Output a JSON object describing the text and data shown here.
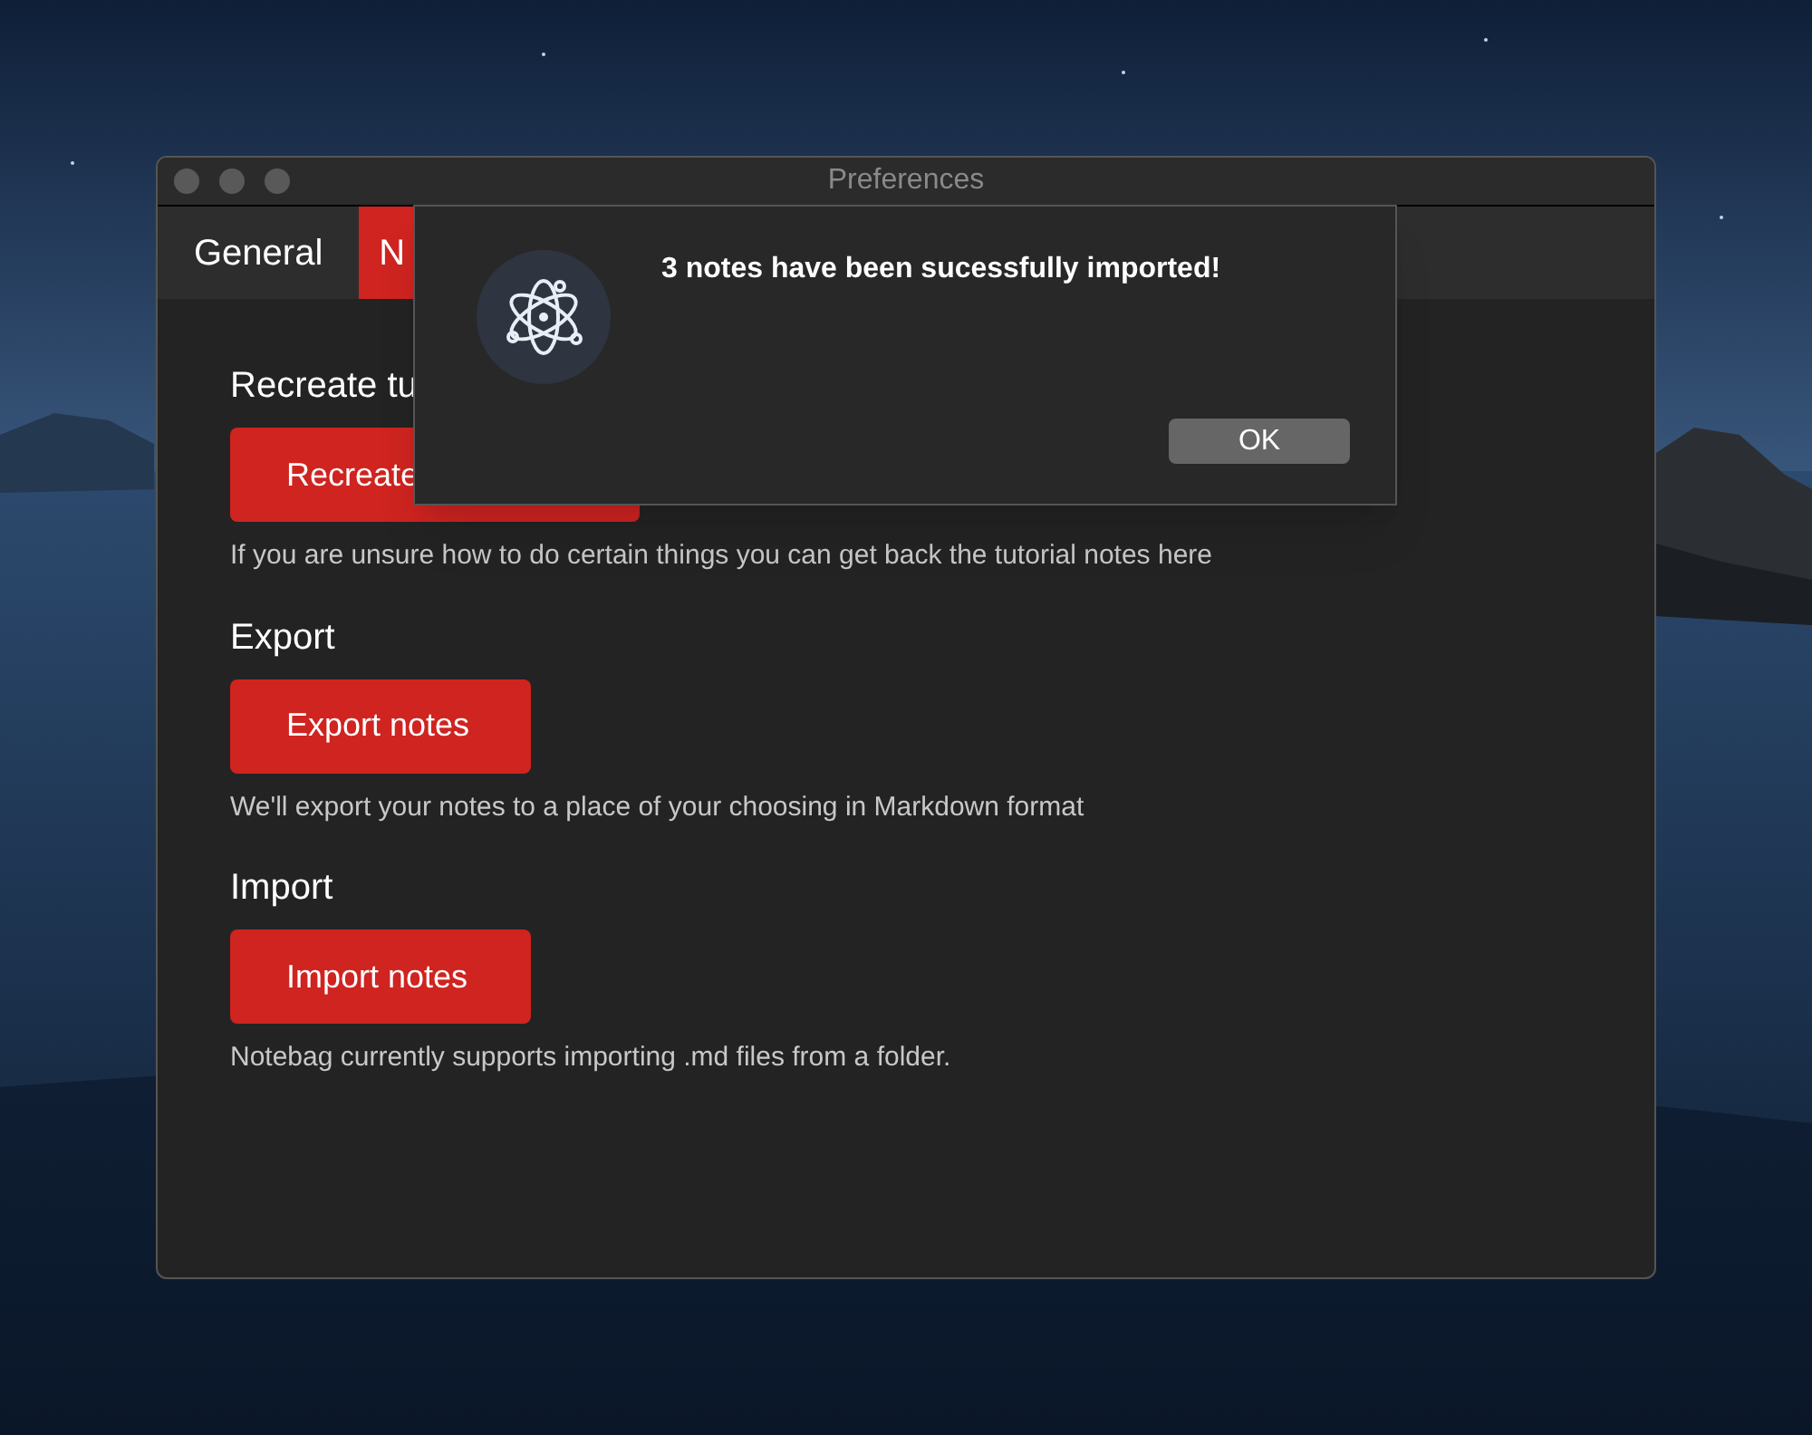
{
  "window": {
    "title": "Preferences"
  },
  "tabs": [
    {
      "label": "General",
      "selected": false
    },
    {
      "label": "N",
      "selected": true
    }
  ],
  "sections": [
    {
      "heading": "Recreate tu",
      "button": "Recreate",
      "description": "If you are unsure how to do certain things you can get back the tutorial notes here"
    },
    {
      "heading": "Export",
      "button": "Export notes",
      "description": "We'll export your notes to a place of your choosing in Markdown format"
    },
    {
      "heading": "Import",
      "button": "Import notes",
      "description": "Notebag currently supports importing .md files from a folder."
    }
  ],
  "dialog": {
    "message": "3 notes have been sucessfully imported!",
    "buttons": [
      "OK"
    ]
  }
}
